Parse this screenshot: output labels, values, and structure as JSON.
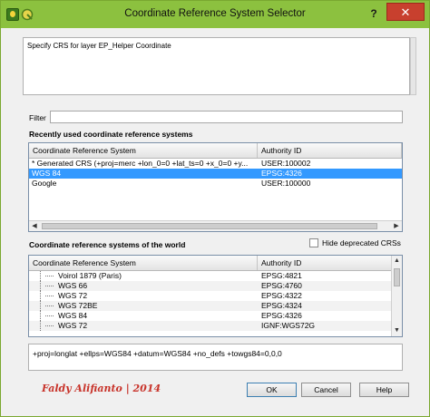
{
  "window": {
    "title": "Coordinate Reference System Selector",
    "help_glyph": "?",
    "close_glyph": "✕"
  },
  "description": "Specify CRS for layer EP_Helper Coordinate",
  "filter": {
    "label": "Filter",
    "value": ""
  },
  "recent": {
    "title": "Recently used coordinate reference systems",
    "columns": [
      "Coordinate Reference System",
      "Authority ID"
    ],
    "rows": [
      {
        "name": "* Generated CRS (+proj=merc +lon_0=0 +lat_ts=0 +x_0=0 +y...",
        "id": "USER:100002"
      },
      {
        "name": "WGS 84",
        "id": "EPSG:4326"
      },
      {
        "name": "Google",
        "id": "USER:100000"
      }
    ],
    "selected_index": 1
  },
  "world": {
    "title": "Coordinate reference systems of the world",
    "hide_deprecated_label": "Hide deprecated CRSs",
    "hide_deprecated_checked": false,
    "columns": [
      "Coordinate Reference System",
      "Authority ID"
    ],
    "rows": [
      {
        "name": "Voirol 1879 (Paris)",
        "id": "EPSG:4821"
      },
      {
        "name": "WGS 66",
        "id": "EPSG:4760"
      },
      {
        "name": "WGS 72",
        "id": "EPSG:4322"
      },
      {
        "name": "WGS 72BE",
        "id": "EPSG:4324"
      },
      {
        "name": "WGS 84",
        "id": "EPSG:4326"
      },
      {
        "name": "WGS 72",
        "id": "IGNF:WGS72G"
      }
    ]
  },
  "proj_string": "+proj=longlat +ellps=WGS84 +datum=WGS84 +no_defs +towgs84=0,0,0",
  "watermark": "Faldy Alifianto | 2014",
  "buttons": {
    "ok": "OK",
    "cancel": "Cancel",
    "help": "Help"
  },
  "colors": {
    "titlebar": "#8cc13f",
    "selection": "#3399ff",
    "close": "#c8402e",
    "watermark": "#c8332a"
  }
}
